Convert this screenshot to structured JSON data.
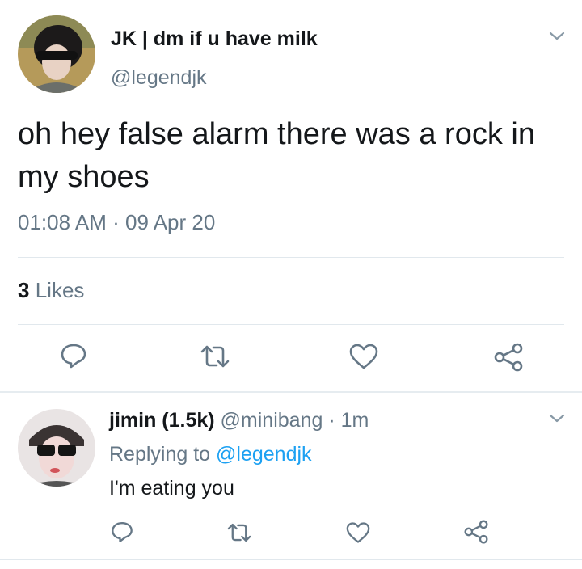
{
  "tweet": {
    "display_name": "JK | dm if u have milk",
    "handle": "@legendjk",
    "text": "oh hey false alarm there was a rock in my shoes",
    "time": "01:08 AM",
    "separator": "·",
    "date": "09 Apr 20",
    "likes_count": "3",
    "likes_label": "Likes",
    "icons": [
      "reply-icon",
      "retweet-icon",
      "like-icon",
      "share-icon"
    ]
  },
  "reply": {
    "display_name": "jimin (1.5k)",
    "handle": "@minibang",
    "separator": "·",
    "age": "1m",
    "replying_prefix": "Replying to",
    "replying_handle": "@legendjk",
    "text": "I'm eating you"
  },
  "colors": {
    "text": "#14171a",
    "muted": "#657786",
    "link": "#1da1f2",
    "divider": "#e1e8ed"
  }
}
